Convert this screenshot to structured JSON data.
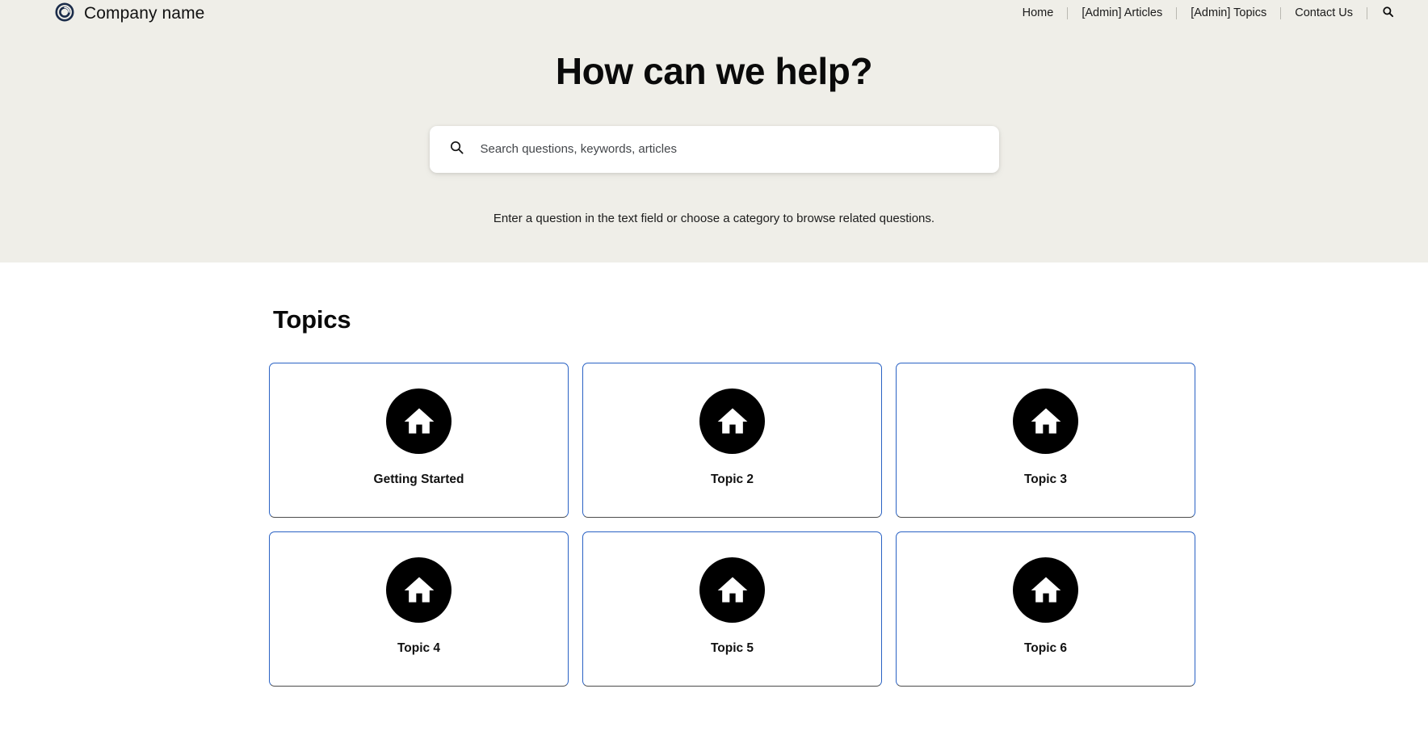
{
  "header": {
    "brand": {
      "logo_icon": "circle-ring-logo-icon",
      "name": "Company name"
    },
    "nav": [
      {
        "label": "Home"
      },
      {
        "label": "[Admin] Articles"
      },
      {
        "label": "[Admin] Topics"
      },
      {
        "label": "Contact Us"
      }
    ],
    "search_icon": "search-icon"
  },
  "hero": {
    "title": "How can we help?",
    "search": {
      "icon": "search-icon",
      "placeholder": "Search questions, keywords, articles",
      "value": ""
    },
    "subtitle": "Enter a question in the text field or choose a category to browse related questions."
  },
  "topics": {
    "title": "Topics",
    "cards": [
      {
        "label": "Getting Started",
        "icon": "home-icon"
      },
      {
        "label": "Topic 2",
        "icon": "home-icon"
      },
      {
        "label": "Topic 3",
        "icon": "home-icon"
      },
      {
        "label": "Topic 4",
        "icon": "home-icon"
      },
      {
        "label": "Topic 5",
        "icon": "home-icon"
      },
      {
        "label": "Topic 6",
        "icon": "home-icon"
      }
    ]
  },
  "colors": {
    "hero_background": "#efeee8",
    "page_background": "#ffffff",
    "card_border": "#2a62c4",
    "card_border_bottom": "#4c4c4c",
    "icon_circle": "#000000",
    "text": "#111111"
  }
}
